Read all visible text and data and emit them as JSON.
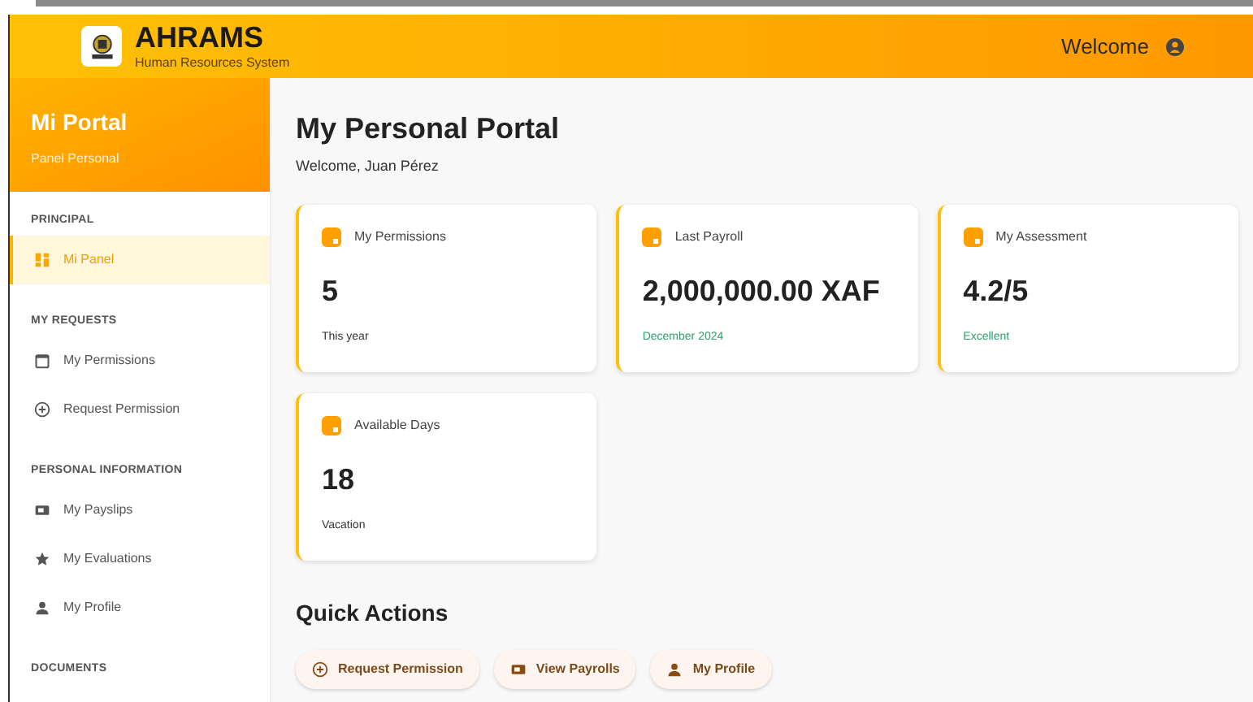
{
  "header": {
    "title": "AHRAMS",
    "subtitle": "Human Resources System",
    "welcome": "Welcome"
  },
  "sidebar": {
    "title": "Mi Portal",
    "subtitle": "Panel Personal",
    "sections": [
      {
        "heading": "PRINCIPAL",
        "items": [
          {
            "label": "Mi Panel",
            "selected": true
          }
        ]
      },
      {
        "heading": "MY REQUESTS",
        "items": [
          {
            "label": "My Permissions",
            "selected": false
          },
          {
            "label": "Request Permission",
            "selected": false
          }
        ]
      },
      {
        "heading": "PERSONAL INFORMATION",
        "items": [
          {
            "label": "My Payslips",
            "selected": false
          },
          {
            "label": "My Evaluations",
            "selected": false
          },
          {
            "label": "My Profile",
            "selected": false
          }
        ]
      },
      {
        "heading": "DOCUMENTS"
      }
    ]
  },
  "main": {
    "title": "My Personal Portal",
    "subtitle": "Welcome, Juan Pérez",
    "cards": [
      {
        "label": "My Permissions",
        "value": "5",
        "note": "This year",
        "color": "#333333"
      },
      {
        "label": "Last Payroll",
        "value": "2,000,000.00 XAF",
        "note": "December 2024",
        "color": "#2e9e6a"
      },
      {
        "label": "My Assessment",
        "value": "4.2/5",
        "note": "Excellent",
        "color": "#2e9e6a"
      },
      {
        "label": "Available Days",
        "value": "18",
        "note": "Vacation",
        "color": "#333333"
      }
    ],
    "quick_actions": {
      "title": "Quick Actions",
      "buttons": [
        {
          "label": "Request Permission"
        },
        {
          "label": "View Payrolls"
        },
        {
          "label": "My Profile"
        }
      ]
    }
  }
}
